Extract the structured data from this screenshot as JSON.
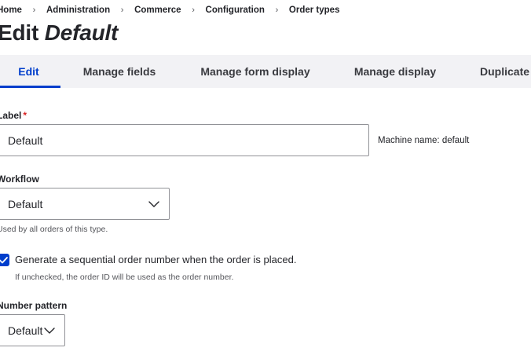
{
  "breadcrumb": {
    "items": [
      "Home",
      "Administration",
      "Commerce",
      "Configuration",
      "Order types"
    ],
    "separator": "›"
  },
  "title": {
    "prefix": "Edit",
    "name": "Default"
  },
  "tabs": [
    {
      "label": "Edit",
      "active": true
    },
    {
      "label": "Manage fields",
      "active": false
    },
    {
      "label": "Manage form display",
      "active": false
    },
    {
      "label": "Manage display",
      "active": false
    },
    {
      "label": "Duplicate",
      "active": false
    }
  ],
  "form": {
    "label_field": {
      "label": "Label",
      "required_marker": "*",
      "value": "Default",
      "machine_name": "Machine name: default"
    },
    "workflow": {
      "label": "Workflow",
      "selected": "Default",
      "help": "Used by all orders of this type."
    },
    "sequential": {
      "checked": true,
      "label": "Generate a sequential order number when the order is placed.",
      "help": "If unchecked, the order ID will be used as the order number."
    },
    "number_pattern": {
      "label": "Number pattern",
      "selected": "Default"
    }
  },
  "colors": {
    "accent": "#003ecc",
    "required": "#d72222",
    "tab_bar_bg": "#f2f2f5",
    "text": "#232429"
  },
  "icons": {
    "select_chevron": "chevron-down-icon",
    "checkbox_check": "check-icon"
  }
}
